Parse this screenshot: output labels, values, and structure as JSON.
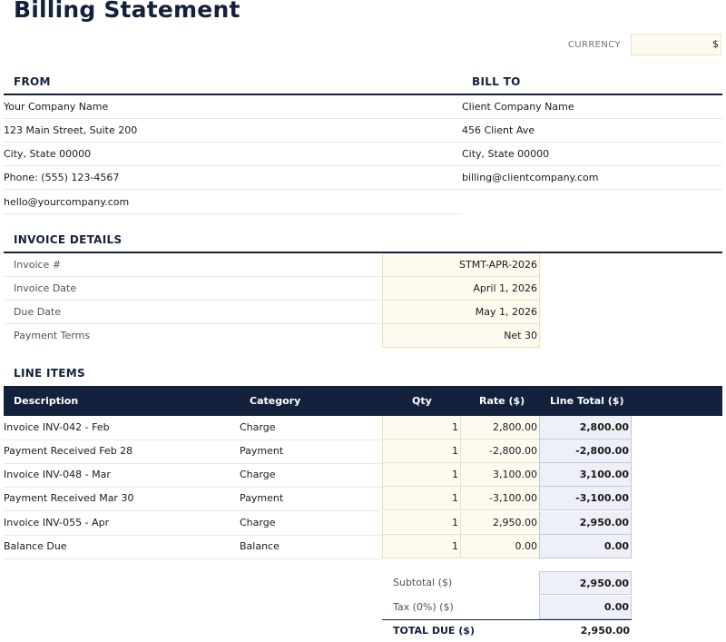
{
  "doc": {
    "title": "Billing Statement",
    "currency_label": "CURRENCY",
    "currency_value": "$"
  },
  "from": {
    "heading": "FROM",
    "lines": [
      "Your Company Name",
      "123 Main Street, Suite 200",
      "City, State 00000",
      "Phone: (555) 123-4567",
      "hello@yourcompany.com"
    ]
  },
  "bill_to": {
    "heading": "BILL TO",
    "lines": [
      "Client Company Name",
      "456 Client Ave",
      "City, State 00000",
      "billing@clientcompany.com"
    ]
  },
  "details": {
    "heading": "INVOICE DETAILS",
    "rows": [
      {
        "label": "Invoice #",
        "value": "STMT-APR-2026"
      },
      {
        "label": "Invoice Date",
        "value": "April 1, 2026"
      },
      {
        "label": "Due Date",
        "value": "May 1, 2026"
      },
      {
        "label": "Payment Terms",
        "value": "Net 30"
      }
    ]
  },
  "line_items": {
    "heading": "LINE ITEMS",
    "columns": [
      "Description",
      "Category",
      "Qty",
      "Rate ($)",
      "Line Total ($)"
    ],
    "rows": [
      {
        "description": "Invoice INV-042 - Feb",
        "category": "Charge",
        "qty": "1",
        "rate": "2,800.00",
        "total": "2,800.00"
      },
      {
        "description": "Payment Received Feb 28",
        "category": "Payment",
        "qty": "1",
        "rate": "-2,800.00",
        "total": "-2,800.00"
      },
      {
        "description": "Invoice INV-048 - Mar",
        "category": "Charge",
        "qty": "1",
        "rate": "3,100.00",
        "total": "3,100.00"
      },
      {
        "description": "Payment Received Mar 30",
        "category": "Payment",
        "qty": "1",
        "rate": "-3,100.00",
        "total": "-3,100.00"
      },
      {
        "description": "Invoice INV-055 - Apr",
        "category": "Charge",
        "qty": "1",
        "rate": "2,950.00",
        "total": "2,950.00"
      },
      {
        "description": "Balance Due",
        "category": "Balance",
        "qty": "1",
        "rate": "0.00",
        "total": "0.00"
      }
    ]
  },
  "summary": {
    "subtotal_label": "Subtotal ($)",
    "subtotal_value": "2,950.00",
    "tax_label": "Tax (0%) ($)",
    "tax_value": "0.00",
    "total_label": "TOTAL DUE ($)",
    "total_value": "2,950.00"
  }
}
